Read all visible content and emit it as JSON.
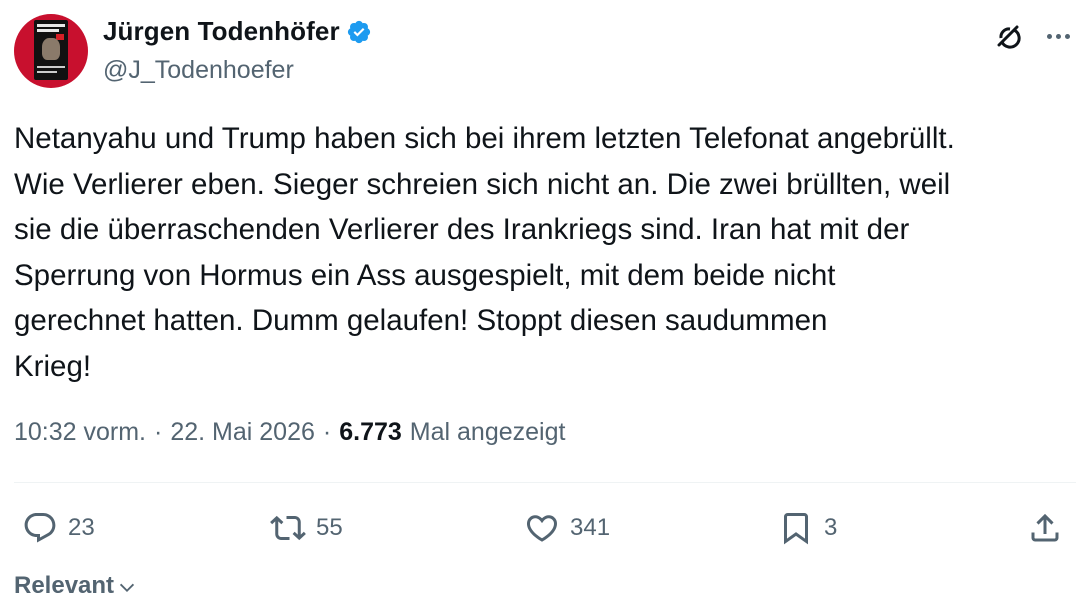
{
  "author": {
    "display_name": "Jürgen Todenhöfer",
    "handle": "@J_Todenhoefer",
    "verified": true,
    "avatar_text": "JÜRGEN TODENHÖFER"
  },
  "tweet": {
    "text": "Netanyahu und Trump haben sich bei ihrem letzten Telefonat angebrüllt.\nWie Verlierer eben. Sieger schreien sich nicht an. Die zwei brüllten, weil\nsie die überraschenden Verlierer des Irankriegs sind. Iran hat mit der\nSperrung von Hormus ein Ass ausgespielt, mit dem beide nicht\ngerechnet hatten. Dumm gelaufen! Stoppt diesen saudummen\nKrieg!",
    "time": "10:32 vorm.",
    "separator": "·",
    "date": "22. Mai 2026",
    "views_count": "6.773",
    "views_label": "Mal angezeigt"
  },
  "actions": {
    "replies": "23",
    "retweets": "55",
    "likes": "341",
    "bookmarks": "3"
  },
  "sort": {
    "label": "Relevant"
  },
  "icons": {
    "verified": "verified-badge-icon",
    "grok": "grok-icon",
    "more": "more-options-icon",
    "reply": "reply-icon",
    "retweet": "retweet-icon",
    "like": "heart-icon",
    "bookmark": "bookmark-icon",
    "share": "share-icon",
    "chevron": "chevron-down-icon"
  },
  "colors": {
    "verified_blue": "#1d9bf0",
    "text_primary": "#0f1419",
    "text_secondary": "#536471",
    "avatar_bg": "#c8102e"
  }
}
